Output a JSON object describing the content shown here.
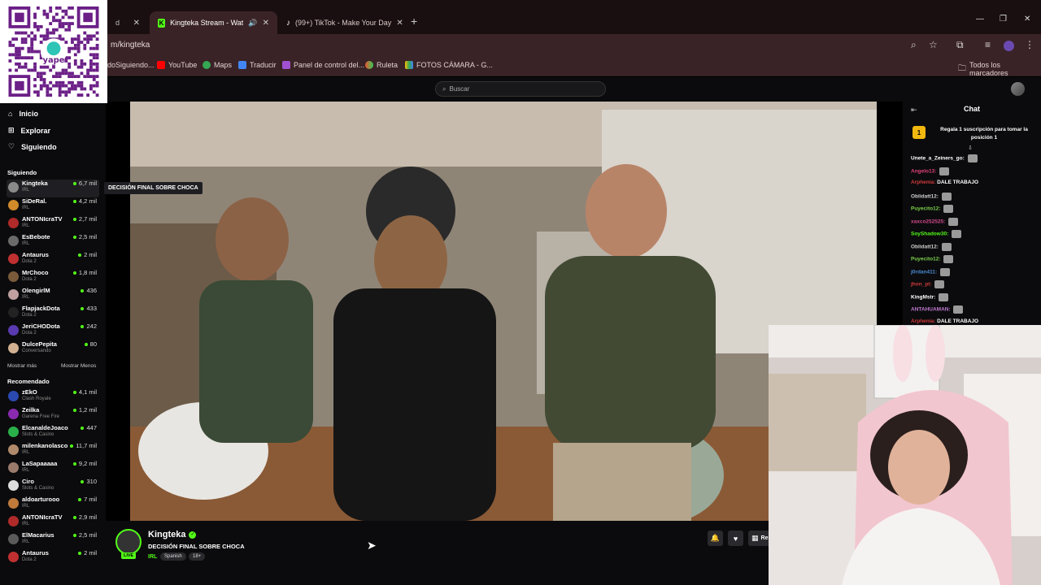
{
  "browser": {
    "tabs": [
      {
        "title": "Kingteka Stream - Watch Li",
        "active": true
      },
      {
        "title": "(99+) TikTok - Make Your Day",
        "active": false
      }
    ],
    "url": "m/kingteka",
    "bookmarks": [
      "doSiguiendo...",
      "YouTube",
      "Maps",
      "Traducir",
      "Panel de control del...",
      "Ruleta",
      "FOTOS CÁMARA - G..."
    ],
    "all_bookmarks": "Todos los marcadores"
  },
  "kick": {
    "search_placeholder": "Buscar",
    "nav": [
      {
        "label": "Inicio",
        "icon": "home-icon"
      },
      {
        "label": "Explorar",
        "icon": "compass-icon"
      },
      {
        "label": "Siguiendo",
        "icon": "heart-icon"
      }
    ],
    "following_title": "Siguiendo",
    "following": [
      {
        "name": "Kingteka",
        "category": "IRL",
        "viewers": "6,7 mil",
        "color": "#8a8a8a"
      },
      {
        "name": "SiDeRal.",
        "category": "IRL",
        "viewers": "4,2 mil",
        "color": "#d08a2a"
      },
      {
        "name": "ANTONIcraTV",
        "category": "IRL",
        "viewers": "2,7 mil",
        "color": "#b02a2a"
      },
      {
        "name": "EsBebote",
        "category": "IRL",
        "viewers": "2,5 mil",
        "color": "#6a6a6a"
      },
      {
        "name": "Antaurus",
        "category": "Dota 2",
        "viewers": "2 mil",
        "color": "#c03030"
      },
      {
        "name": "MrChoco",
        "category": "Dota 2",
        "viewers": "1,8 mil",
        "color": "#7a5a3a"
      },
      {
        "name": "OlengirlM",
        "category": "IRL",
        "viewers": "436",
        "color": "#c0a0a0"
      },
      {
        "name": "FlapjackDota",
        "category": "Dota 2",
        "viewers": "433",
        "color": "#222222"
      },
      {
        "name": "JeriCHODota",
        "category": "Dota 2",
        "viewers": "242",
        "color": "#5a3ab0"
      },
      {
        "name": "DulcePepita",
        "category": "Conversando",
        "viewers": "80",
        "color": "#d0b090"
      }
    ],
    "show_more": "Mostrar más",
    "show_less": "Mostrar Menos",
    "recommended_title": "Recomendado",
    "recommended": [
      {
        "name": "zEkO",
        "category": "Clash Royale",
        "viewers": "4,1 mil",
        "color": "#2a4ab0"
      },
      {
        "name": "Zeilka",
        "category": "Garena Free Fire",
        "viewers": "1,2 mil",
        "color": "#8a2ab0"
      },
      {
        "name": "ElcanaldeJoaco",
        "category": "Slots & Casino",
        "viewers": "447",
        "color": "#2ab04a"
      },
      {
        "name": "milenkanolasco",
        "category": "IRL",
        "viewers": "11,7 mil",
        "color": "#b08a6a"
      },
      {
        "name": "LaSapaaaaa",
        "category": "IRL",
        "viewers": "9,2 mil",
        "color": "#9a7a6a"
      },
      {
        "name": "Ciro",
        "category": "Slots & Casino",
        "viewers": "310",
        "color": "#dddddd"
      },
      {
        "name": "aldoarturooo",
        "category": "IRL",
        "viewers": "7 mil",
        "color": "#c07a3a"
      },
      {
        "name": "ANTONIcraTV",
        "category": "IRL",
        "viewers": "2,9 mil",
        "color": "#b02a2a"
      },
      {
        "name": "ElMacarius",
        "category": "IRL",
        "viewers": "2,5 mil",
        "color": "#5a5a5a"
      },
      {
        "name": "Antaurus",
        "category": "Dota 2",
        "viewers": "2 mil",
        "color": "#c03030"
      }
    ],
    "tooltip": "DECISIÓN FINAL SOBRE CHOCA",
    "stream": {
      "streamer": "Kingteka",
      "title": "DECISIÓN FINAL SOBRE CHOCA",
      "category": "IRL",
      "tags": [
        "Spanish",
        "18+"
      ],
      "live": "LIVE",
      "action_label": "Re"
    },
    "chat": {
      "title": "Chat",
      "gift_rank": "1",
      "gift_text": "Regala 1 suscripción para tomar la posición 1",
      "messages": [
        {
          "user": "Unete_a_Zeiners_go:",
          "text": "",
          "color": "#ffffff"
        },
        {
          "user": "Angelo13:",
          "text": "",
          "color": "#e0407a"
        },
        {
          "user": "Arphenia:",
          "text": "DALE TRABAJO",
          "color": "#d03a3a"
        },
        {
          "user": "Oblidatt12:",
          "text": "",
          "color": "#cfcfcf"
        },
        {
          "user": "Puyecito12:",
          "text": "",
          "color": "#7ad04a"
        },
        {
          "user": "xaxco252525:",
          "text": "",
          "color": "#d04a8a"
        },
        {
          "user": "SoyShadow30:",
          "text": "",
          "color": "#53fc18"
        },
        {
          "user": "Oblidatt12:",
          "text": "",
          "color": "#cfcfcf"
        },
        {
          "user": "Puyecito12:",
          "text": "",
          "color": "#7ad04a"
        },
        {
          "user": "j0rdan411:",
          "text": "",
          "color": "#4a8ad0"
        },
        {
          "user": "jhon_pt:",
          "text": "",
          "color": "#d03a3a"
        },
        {
          "user": "KingMstr:",
          "text": "",
          "color": "#ffffff"
        },
        {
          "user": "ANTAHUAMAN:",
          "text": "",
          "color": "#c07ad0"
        },
        {
          "user": "Arphenia:",
          "text": "DALE TRABAJO",
          "color": "#d03a3a"
        }
      ]
    }
  }
}
